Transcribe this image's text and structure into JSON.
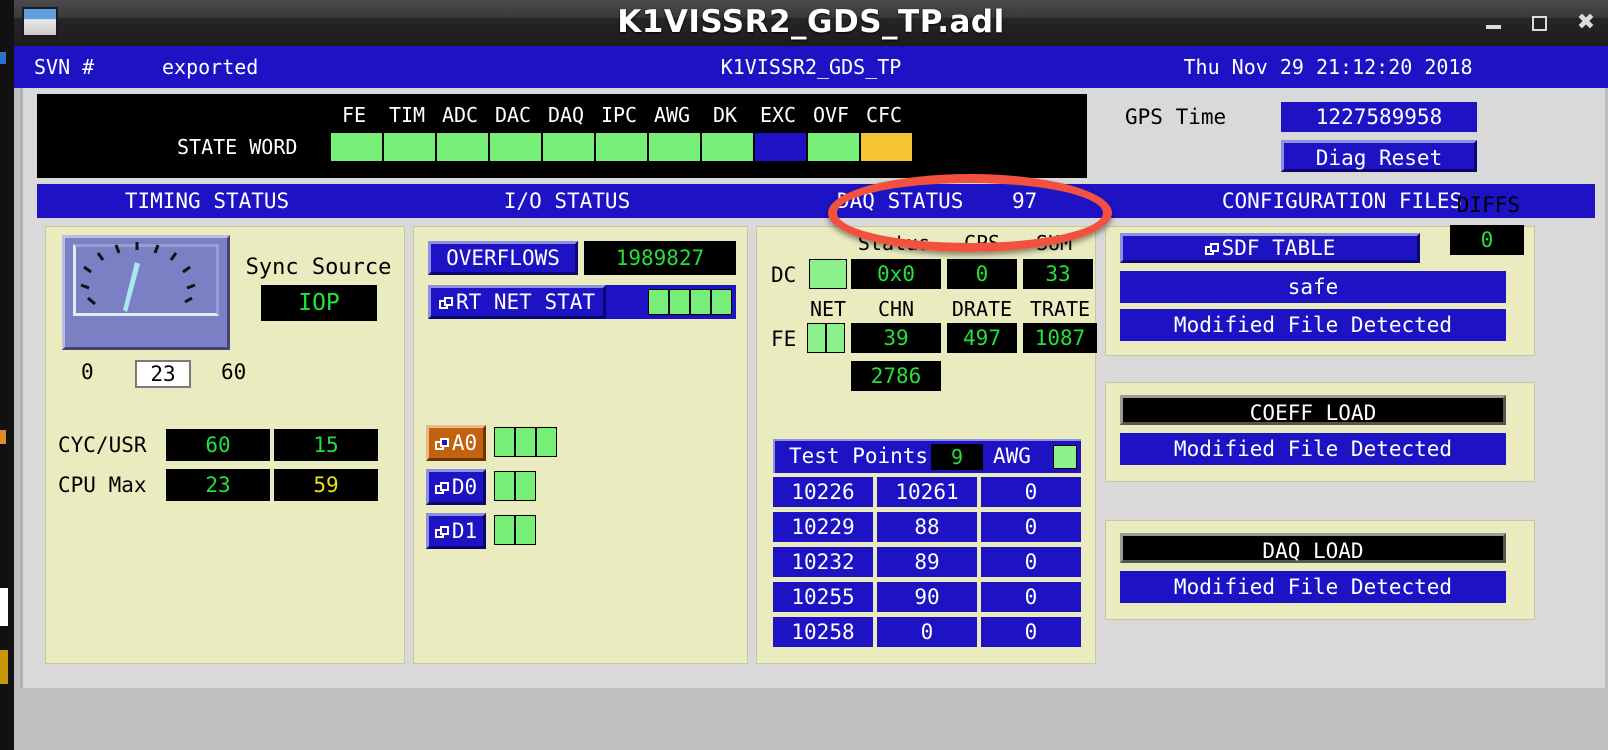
{
  "window": {
    "title": "K1VISSR2_GDS_TP.adl",
    "app_icon": "window-icon",
    "minimize": "–",
    "maximize": "□",
    "close": "✖"
  },
  "svnbar": {
    "label": "SVN #",
    "value": "exported",
    "center": "K1VISSR2_GDS_TP",
    "datetime": "Thu Nov 29 21:12:20 2018"
  },
  "state_word": {
    "row_label": "STATE WORD",
    "bit_labels": [
      "FE",
      "TIM",
      "ADC",
      "DAC",
      "DAQ",
      "IPC",
      "AWG",
      "DK",
      "EXC",
      "OVF",
      "CFC"
    ],
    "bit_colors": [
      "#77ee77",
      "#77ee77",
      "#77ee77",
      "#77ee77",
      "#77ee77",
      "#77ee77",
      "#77ee77",
      "#77ee77",
      "#1d12c4",
      "#77ee77",
      "#f5c431"
    ]
  },
  "gps": {
    "label": "GPS Time",
    "value": "1227589958",
    "diag_reset": "Diag Reset"
  },
  "sections": {
    "timing": "TIMING STATUS",
    "io": "I/O STATUS",
    "daq": "DAQ STATUS",
    "daq_value": "97",
    "config": "CONFIGURATION FILES"
  },
  "timing": {
    "meter_min": "0",
    "meter_max": "60",
    "meter_reading": "23",
    "sync_source_label": "Sync Source",
    "sync_source_value": "IOP",
    "rows": [
      {
        "label": "CYC/USR",
        "v1": "60",
        "v1_color": "#23e03a",
        "v2": "15",
        "v2_color": "#23e03a"
      },
      {
        "label": "CPU Max",
        "v1": "23",
        "v1_color": "#23e03a",
        "v2": "59",
        "v2_color": "#e8e014"
      }
    ]
  },
  "io": {
    "overflows_label": "OVERFLOWS",
    "overflows_value": "1989827",
    "rt_net_stat_label": "RT NET STAT",
    "rt_net_stat_segments": 4,
    "rt_net_stat_color": "#77ee77",
    "channels": [
      {
        "label": "A0",
        "color": "#c2620f",
        "segments": 3,
        "seg_color": "#77ee77"
      },
      {
        "label": "D0",
        "color": "#1d12c4",
        "segments": 2,
        "seg_color": "#77ee77"
      },
      {
        "label": "D1",
        "color": "#1d12c4",
        "segments": 2,
        "seg_color": "#77ee77"
      }
    ]
  },
  "daq": {
    "headers_row1": [
      "Status",
      "CPS",
      "SUM"
    ],
    "dc_label": "DC",
    "dc_led_color": "#8cf08c",
    "dc_status": "0x0",
    "dc_cps": "0",
    "dc_sum": "33",
    "headers_row2": [
      "NET",
      "CHN",
      "DRATE",
      "TRATE"
    ],
    "fe_label": "FE",
    "fe_net_segments": 2,
    "fe_net_color": "#8cf08c",
    "fe_chn": "39",
    "fe_drate": "497",
    "fe_trate": "1087",
    "fe_extra": "2786",
    "test_points": {
      "title": "Test Points",
      "count": "9",
      "awg_label": "AWG",
      "awg_led_color": "#8cf08c",
      "rows": [
        [
          "10226",
          "10261",
          "0"
        ],
        [
          "10229",
          "88",
          "0"
        ],
        [
          "10232",
          "89",
          "0"
        ],
        [
          "10255",
          "90",
          "0"
        ],
        [
          "10258",
          "0",
          "0"
        ]
      ]
    }
  },
  "config": {
    "diffs_label": "DIFFS",
    "diffs_value": "0",
    "sdf_table_button": "SDF TABLE",
    "sdf_state": "safe",
    "sdf_status": "Modified File Detected",
    "coeff_load_label": "COEFF LOAD",
    "coeff_load_status": "Modified File Detected",
    "daq_load_label": "DAQ LOAD",
    "daq_load_status": "Modified File Detected"
  },
  "annotation": {
    "shape": "red-ellipse-highlight",
    "color": "#f2513f",
    "target": "DAQ STATUS 97"
  }
}
